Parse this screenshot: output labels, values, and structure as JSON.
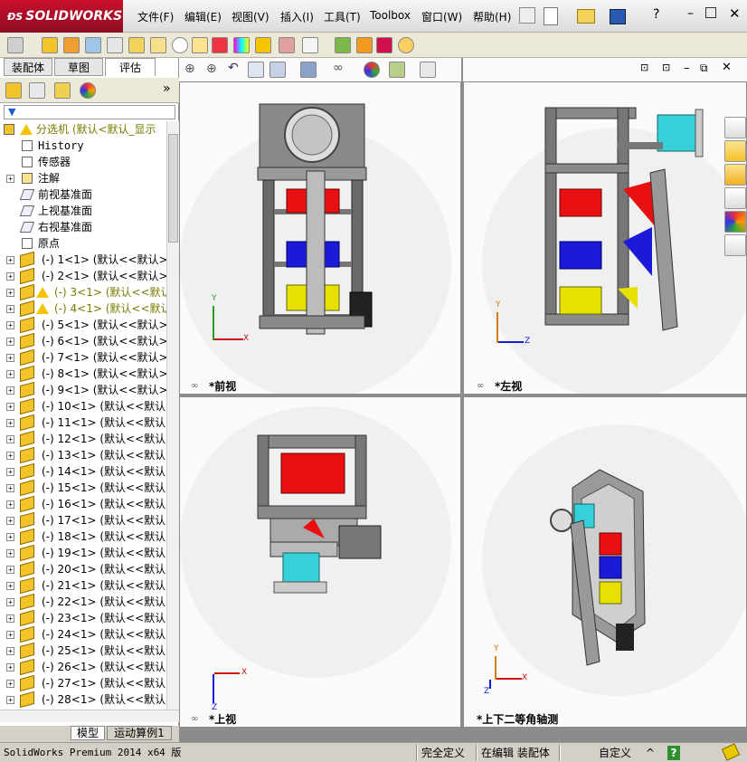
{
  "app": {
    "logo_text": "SOLIDWORKS",
    "menus": [
      "文件(F)",
      "编辑(E)",
      "视图(V)",
      "插入(I)",
      "工具(T)",
      "Toolbox",
      "窗口(W)",
      "帮助(H)"
    ]
  },
  "panel_tabs": [
    "装配体",
    "草图",
    "评估"
  ],
  "tree": {
    "root": "分选机  (默认<默认_显示",
    "fixed_items": [
      "History",
      "传感器",
      "注解",
      "前视基准面",
      "上视基准面",
      "右视基准面",
      "原点"
    ],
    "parts": [
      "(-) 1<1> (默认<<默认>_显",
      "(-) 2<1> (默认<<默认>_显",
      "(-) 3<1> (默认<<默认",
      "(-) 4<1> (默认<<默认",
      "(-) 5<1> (默认<<默认>_显",
      "(-) 6<1> (默认<<默认>_显",
      "(-) 7<1> (默认<<默认>_显",
      "(-) 8<1> (默认<<默认>_显",
      "(-) 9<1> (默认<<默认>_显",
      "(-) 10<1> (默认<<默认>_",
      "(-) 11<1> (默认<<默认>_",
      "(-) 12<1> (默认<<默认>_",
      "(-) 13<1> (默认<<默认>_",
      "(-) 14<1> (默认<<默认>_",
      "(-) 15<1> (默认<<默认>_",
      "(-) 16<1> (默认<<默认>_",
      "(-) 17<1> (默认<<默认>_",
      "(-) 18<1> (默认<<默认>_",
      "(-) 19<1> (默认<<默认>_",
      "(-) 20<1> (默认<<默认>_",
      "(-) 21<1> (默认<<默认>_",
      "(-) 22<1> (默认<<默认>_",
      "(-) 23<1> (默认<<默认>_",
      "(-) 24<1> (默认<<默认>_",
      "(-) 25<1> (默认<<默认>_",
      "(-) 26<1> (默认<<默认>_",
      "(-) 27<1> (默认<<默认>_",
      "(-) 28<1> (默认<<默认>_"
    ],
    "warning_parts": [
      2,
      3
    ]
  },
  "bottom_tabs": [
    "模型",
    "运动算例1"
  ],
  "views": {
    "front": "*前视",
    "left": "*左视",
    "top": "*上视",
    "iso": "*上下二等角轴测"
  },
  "axes": {
    "x": "X",
    "y": "Y",
    "z": "Z"
  },
  "status": {
    "product": "SolidWorks Premium 2014 x64 版",
    "definition": "完全定义",
    "mode": "在编辑 装配体",
    "units": "自定义",
    "help": "?"
  },
  "colors": {
    "red": "#e81010",
    "blue": "#1a1ad8",
    "yellow": "#e8e000",
    "cyan": "#35d0d8",
    "frame": "#707070"
  }
}
